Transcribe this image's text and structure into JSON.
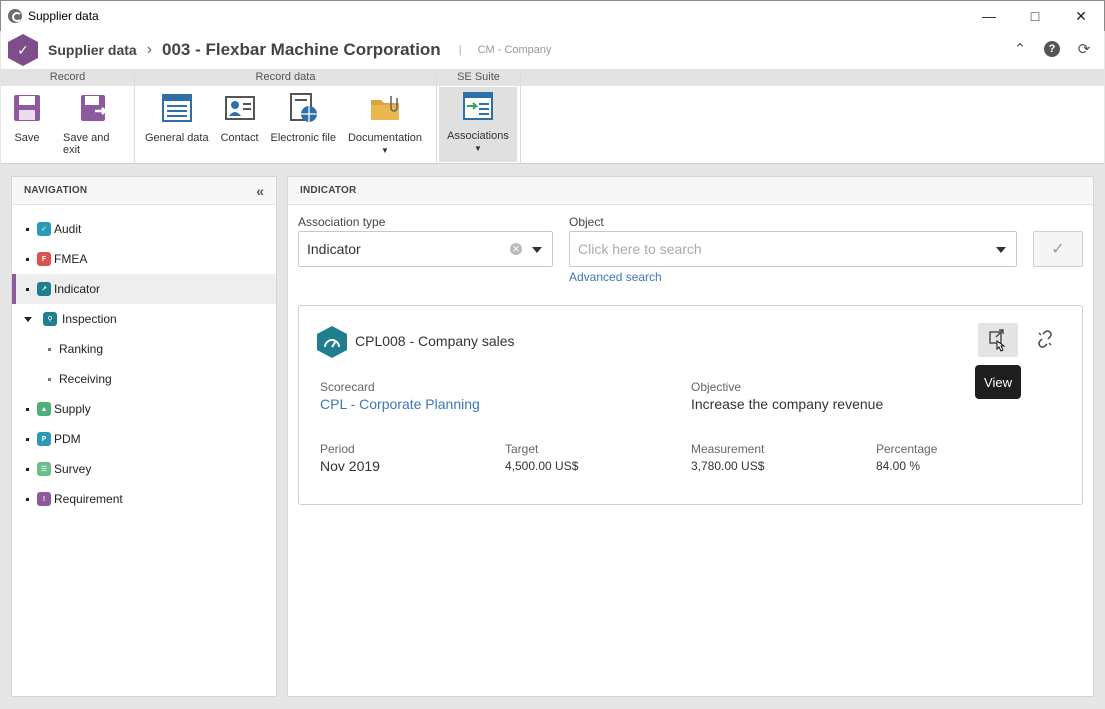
{
  "window": {
    "title": "Supplier data"
  },
  "header": {
    "app": "Supplier data",
    "record_title": "003 - Flexbar Machine Corporation",
    "divider": "|",
    "subtitle": "CM - Company"
  },
  "ribbon": {
    "groups": [
      {
        "label": "Record",
        "buttons": [
          {
            "label": "Save",
            "icon": "save-icon"
          },
          {
            "label": "Save and exit",
            "icon": "save-exit-icon"
          }
        ]
      },
      {
        "label": "Record data",
        "buttons": [
          {
            "label": "General data",
            "icon": "general-data-icon"
          },
          {
            "label": "Contact",
            "icon": "contact-icon"
          },
          {
            "label": "Electronic file",
            "icon": "electronic-file-icon"
          },
          {
            "label": "Documentation",
            "icon": "documentation-icon"
          }
        ]
      },
      {
        "label": "SE Suite",
        "buttons": [
          {
            "label": "Associations",
            "icon": "associations-icon"
          }
        ]
      }
    ]
  },
  "navigation": {
    "title": "NAVIGATION",
    "items": [
      {
        "label": "Audit",
        "icon": "audit-icon",
        "color": "#2a9bb5"
      },
      {
        "label": "FMEA",
        "icon": "fmea-icon",
        "color": "#d9534f"
      },
      {
        "label": "Indicator",
        "icon": "indicator-icon",
        "color": "#1f7f8e"
      },
      {
        "label": "Inspection",
        "icon": "inspection-icon",
        "color": "#1f7f8e"
      },
      {
        "label": "Ranking"
      },
      {
        "label": "Receiving"
      },
      {
        "label": "Supply",
        "icon": "supply-icon",
        "color": "#4caf7a"
      },
      {
        "label": "PDM",
        "icon": "pdm-icon",
        "color": "#2a9bb5"
      },
      {
        "label": "Survey",
        "icon": "survey-icon",
        "color": "#6dbf8a"
      },
      {
        "label": "Requirement",
        "icon": "requirement-icon",
        "color": "#8d5aa0"
      }
    ]
  },
  "main": {
    "title": "INDICATOR",
    "association_type": {
      "label": "Association type",
      "value": "Indicator"
    },
    "object": {
      "label": "Object",
      "placeholder": "Click here to search"
    },
    "advanced_search": "Advanced search",
    "card": {
      "title": "CPL008 - Company sales",
      "tooltip": "View",
      "scorecard_label": "Scorecard",
      "scorecard_value": "CPL - Corporate Planning",
      "objective_label": "Objective",
      "objective_value": "Increase the company revenue",
      "period_label": "Period",
      "period_value": "Nov 2019",
      "target_label": "Target",
      "target_value": "4,500.00 US$",
      "measurement_label": "Measurement",
      "measurement_value": "3,780.00 US$",
      "percentage_label": "Percentage",
      "percentage_value": "84.00 %"
    }
  },
  "colors": {
    "accent": "#8d5aa0",
    "link": "#3a78b8",
    "indicator_teal": "#1f7f8e"
  }
}
